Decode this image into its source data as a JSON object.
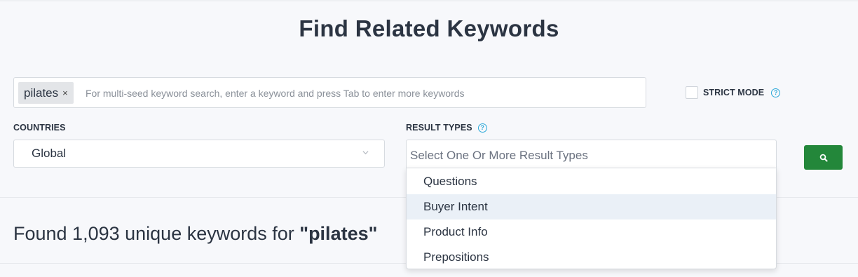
{
  "page": {
    "title": "Find Related Keywords"
  },
  "seed": {
    "chips": [
      {
        "label": "pilates",
        "remove": "×"
      }
    ],
    "placeholder": "For multi-seed keyword search, enter a keyword and press Tab to enter more keywords"
  },
  "strict_mode": {
    "label": "STRICT MODE",
    "checked": false,
    "help": "?"
  },
  "countries": {
    "label": "COUNTRIES",
    "selected": "Global"
  },
  "result_types": {
    "label": "RESULT TYPES",
    "help": "?",
    "placeholder": "Select One Or More Result Types",
    "options": [
      "Questions",
      "Buyer Intent",
      "Product Info",
      "Prepositions"
    ],
    "highlighted": "Buyer Intent"
  },
  "search_button": {
    "icon": "search-icon",
    "color": "#23873a"
  },
  "results": {
    "prefix": "Found 1,093 unique keywords for ",
    "keyword": "\"pilates\""
  },
  "colors": {
    "accent_help": "#2ba8d8",
    "button_green": "#23873a",
    "text": "#2b3442",
    "highlight": "#eaf0f7"
  }
}
